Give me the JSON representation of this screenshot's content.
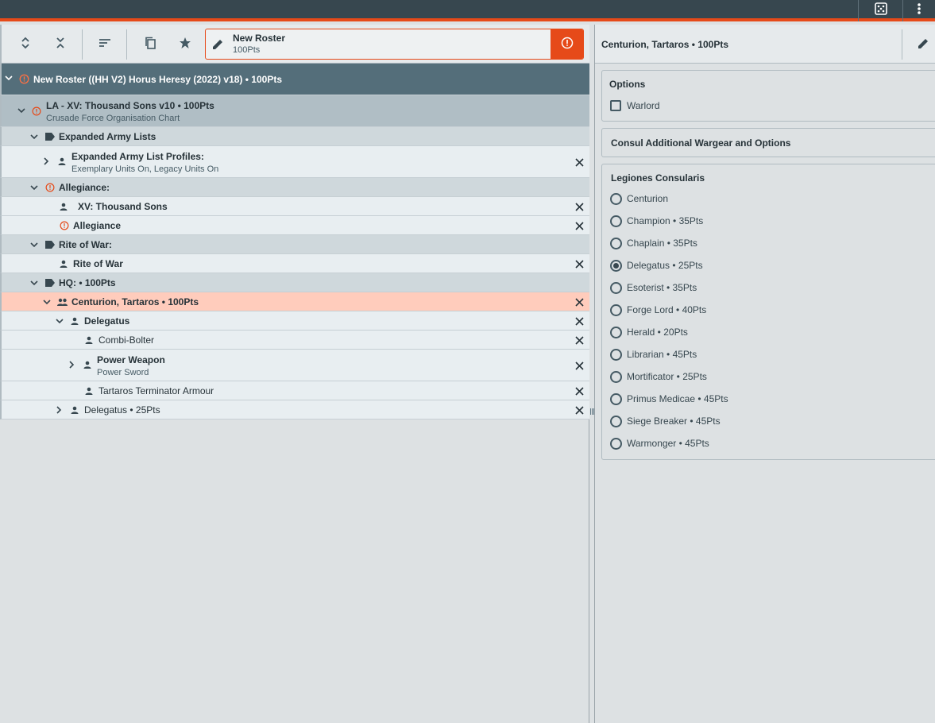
{
  "topbar": {
    "dice_icon": "dice-icon",
    "menu_icon": "kebab-menu-icon"
  },
  "toolbar": {
    "expand": "expand-all",
    "collapse": "collapse-all",
    "sort": "sort",
    "copy": "copy",
    "star": "favorite"
  },
  "roster": {
    "name": "New Roster",
    "points": "100Pts"
  },
  "tree": {
    "root": "New Roster ((HH V2) Horus Heresy (2022) v18) • 100Pts",
    "force": {
      "title": "LA -  XV: Thousand Sons v10 • 100Pts",
      "subtitle": "Crusade Force Organisation Chart"
    },
    "cat_expanded": "Expanded Army Lists",
    "expanded_profiles": {
      "title": "Expanded Army List Profiles:",
      "subtitle": "Exemplary Units On, Legacy Units On"
    },
    "cat_allegiance": "Allegiance:",
    "thousand_sons": "XV: Thousand Sons",
    "allegiance": "Allegiance",
    "cat_rite": "Rite of War:",
    "rite": "Rite of War",
    "cat_hq": "HQ: • 100Pts",
    "centurion": "Centurion, Tartaros  • 100Pts",
    "delegatus": "Delegatus",
    "combi": "Combi-Bolter",
    "power_weapon": {
      "title": "Power Weapon",
      "subtitle": "Power Sword"
    },
    "armour": "Tartaros Terminator Armour",
    "delegatus2": "Delegatus  • 25Pts"
  },
  "panel": {
    "title": "Centurion, Tartaros  • 100Pts",
    "options_header": "Options",
    "warlord": "Warlord",
    "consul_header": "Consul Additional Wargear and Options",
    "legiones_header": "Legiones Consularis",
    "consuls": [
      {
        "label": "Centurion",
        "checked": false
      },
      {
        "label": "Champion • 35Pts",
        "checked": false
      },
      {
        "label": "Chaplain • 35Pts",
        "checked": false
      },
      {
        "label": "Delegatus  • 25Pts",
        "checked": true
      },
      {
        "label": "Esoterist • 35Pts",
        "checked": false
      },
      {
        "label": "Forge Lord • 40Pts",
        "checked": false
      },
      {
        "label": "Herald • 20Pts",
        "checked": false
      },
      {
        "label": "Librarian • 45Pts",
        "checked": false
      },
      {
        "label": "Mortificator • 25Pts",
        "checked": false
      },
      {
        "label": "Primus Medicae • 45Pts",
        "checked": false
      },
      {
        "label": "Siege Breaker • 45Pts",
        "checked": false
      },
      {
        "label": "Warmonger • 45Pts",
        "checked": false
      }
    ]
  },
  "colors": {
    "accent": "#e64a19",
    "header": "#37474f",
    "root_row": "#546e7a",
    "selected_row": "#ffccbc"
  }
}
